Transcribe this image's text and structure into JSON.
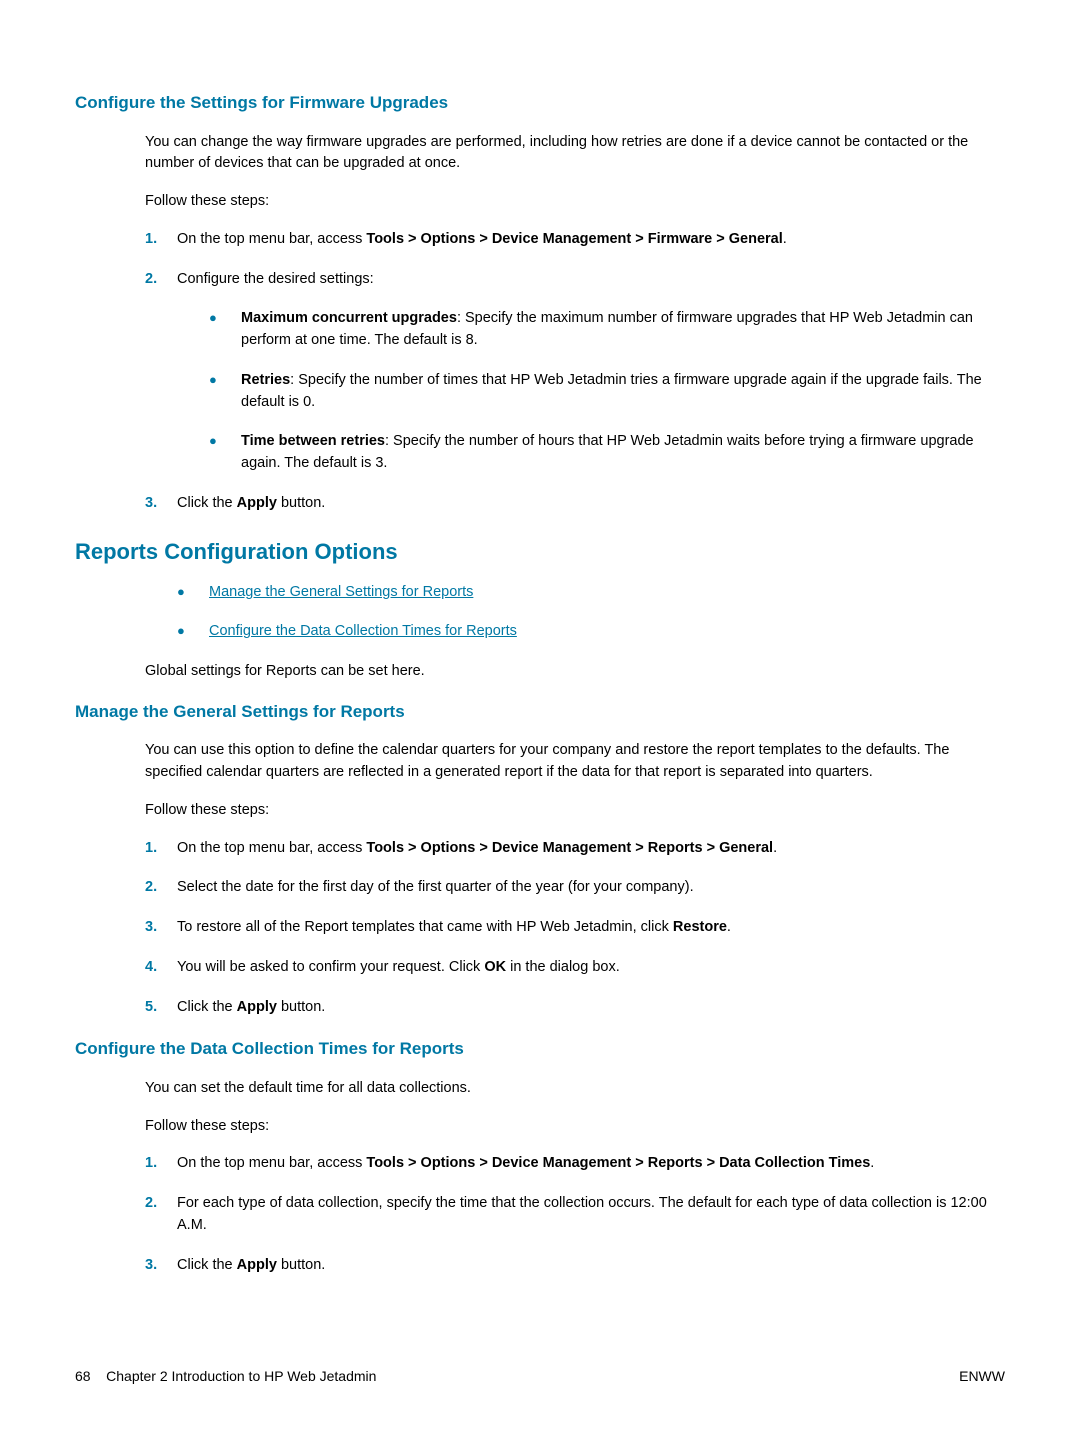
{
  "section1": {
    "heading": "Configure the Settings for Firmware Upgrades",
    "intro": "You can change the way firmware upgrades are performed, including how retries are done if a device cannot be contacted or the number of devices that can be upgraded at once.",
    "follow": "Follow these steps:",
    "step1_pre": "On the top menu bar, access ",
    "step1_bold": "Tools > Options > Device Management > Firmware > General",
    "step1_post": ".",
    "step2": "Configure the desired settings:",
    "bullet1_bold": "Maximum concurrent upgrades",
    "bullet1_text": ": Specify the maximum number of firmware upgrades that HP Web Jetadmin can perform at one time. The default is 8.",
    "bullet2_bold": "Retries",
    "bullet2_text": ": Specify the number of times that HP Web Jetadmin tries a firmware upgrade again if the upgrade fails. The default is 0.",
    "bullet3_bold": "Time between retries",
    "bullet3_text": ": Specify the number of hours that HP Web Jetadmin waits before trying a firmware upgrade again. The default is 3.",
    "step3_pre": "Click the ",
    "step3_bold": "Apply",
    "step3_post": " button."
  },
  "section2": {
    "heading": "Reports Configuration Options",
    "link1": "Manage the General Settings for Reports",
    "link2": "Configure the Data Collection Times for Reports",
    "global": "Global settings for Reports can be set here."
  },
  "section3": {
    "heading": "Manage the General Settings for Reports",
    "intro": "You can use this option to define the calendar quarters for your company and restore the report templates to the defaults. The specified calendar quarters are reflected in a generated report if the data for that report is separated into quarters.",
    "follow": "Follow these steps:",
    "step1_pre": "On the top menu bar, access ",
    "step1_bold": "Tools > Options > Device Management > Reports > General",
    "step1_post": ".",
    "step2": "Select the date for the first day of the first quarter of the year (for your company).",
    "step3_pre": "To restore all of the Report templates that came with HP Web Jetadmin, click ",
    "step3_bold": "Restore",
    "step3_post": ".",
    "step4_pre": "You will be asked to confirm your request. Click ",
    "step4_bold": "OK",
    "step4_post": " in the dialog box.",
    "step5_pre": "Click the ",
    "step5_bold": "Apply",
    "step5_post": " button."
  },
  "section4": {
    "heading": "Configure the Data Collection Times for Reports",
    "intro": "You can set the default time for all data collections.",
    "follow": "Follow these steps:",
    "step1_pre": "On the top menu bar, access ",
    "step1_bold": "Tools > Options > Device Management > Reports > Data Collection Times",
    "step1_post": ".",
    "step2": "For each type of data collection, specify the time that the collection occurs. The default for each type of data collection is 12:00 A.M.",
    "step3_pre": "Click the ",
    "step3_bold": "Apply",
    "step3_post": " button."
  },
  "footer": {
    "left_page": "68",
    "left_text": "Chapter 2   Introduction to HP Web Jetadmin",
    "right": "ENWW"
  },
  "numbers": {
    "n1": "1.",
    "n2": "2.",
    "n3": "3.",
    "n4": "4.",
    "n5": "5."
  },
  "bullet": "●"
}
